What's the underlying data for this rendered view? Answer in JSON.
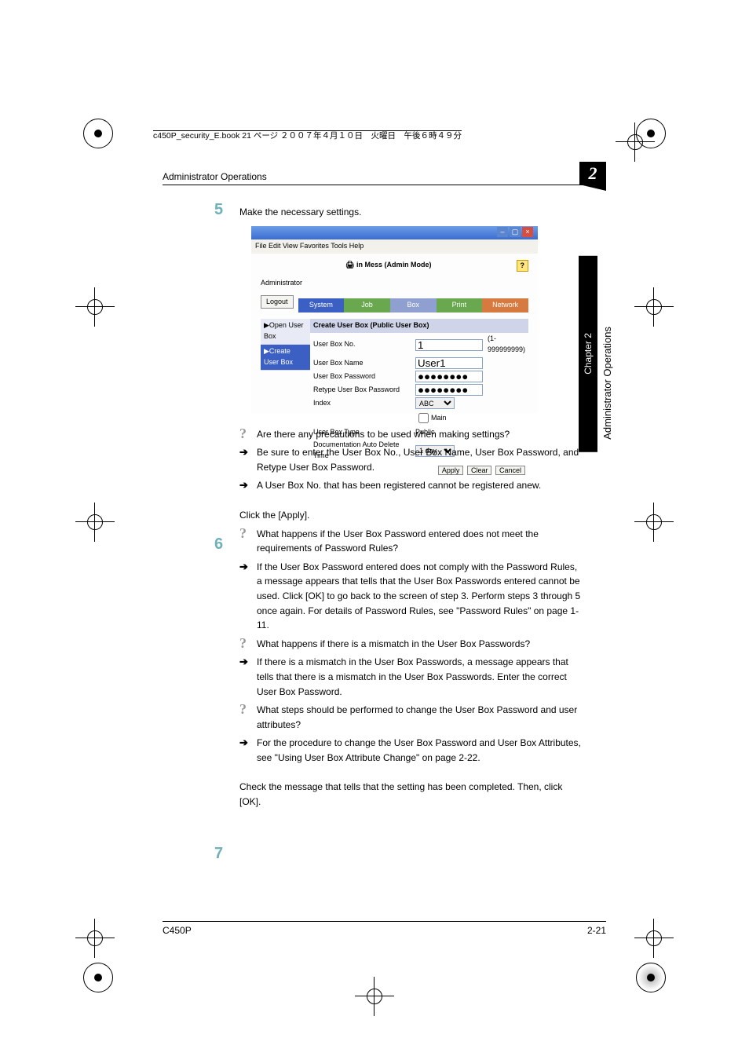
{
  "ruler": "c450P_security_E.book  21 ページ  ２００７年４月１０日　火曜日　午後６時４９分",
  "header": "Administrator Operations",
  "chapnum": "2",
  "side": {
    "chapter": "Chapter 2",
    "title": "Administrator Operations"
  },
  "steps": {
    "s5": "5",
    "s6": "6",
    "s7": "7"
  },
  "s5": {
    "t": "Make the necessary settings."
  },
  "shot": {
    "menus": "File   Edit   View   Favorites   Tools   Help",
    "title": "in Mess (Admin Mode)",
    "role": "Administrator",
    "logout": "Logout",
    "tabs": [
      "System",
      "Job",
      "Box",
      "Print",
      "Network"
    ],
    "nav": [
      "▶Open User Box",
      "▶Create User Box"
    ],
    "fh": "Create User Box (Public User Box)",
    "rows": {
      "no": {
        "l": "User Box No.",
        "v": "1",
        "h": "(1-999999999)"
      },
      "name": {
        "l": "User Box Name",
        "v": "User1"
      },
      "pw": {
        "l": "User Box Password",
        "v": "●●●●●●●●"
      },
      "rpw": {
        "l": "Retype User Box Password",
        "v": "●●●●●●●●"
      },
      "idx": {
        "l": "Index",
        "v": "ABC",
        "m": "Main"
      },
      "type": {
        "l": "User Box Type",
        "v": "Public"
      },
      "del": {
        "l": "Documentation Auto Delete Time",
        "v": "1 day"
      }
    },
    "btns": {
      "a": "Apply",
      "c": "Clear",
      "x": "Cancel"
    }
  },
  "q1": "Are there any precautions to be used when making settings?",
  "a1": "Be sure to enter the User Box No., User Box Name, User Box Password, and Retype User Box Password.",
  "a1b": "A User Box No. that has been registered cannot be registered anew.",
  "s6": {
    "t": "Click the [Apply]."
  },
  "q2": "What happens if the User Box Password entered does not meet the requirements of Password Rules?",
  "a2": "If the User Box Password entered does not comply with the Password Rules, a message appears that tells that the User Box Passwords entered cannot be used. Click [OK] to go back to the screen of step 3. Perform steps 3 through 5 once again. For details of Password Rules, see \"Password Rules\" on page 1-11.",
  "q3": "What happens if there is a mismatch in the User Box Passwords?",
  "a3": "If there is a mismatch in the User Box Passwords, a message appears that tells that there is a mismatch in the User Box Passwords. Enter the correct User Box Password.",
  "q4": "What steps should be performed to change the User Box Password and user attributes?",
  "a4": "For the procedure to change the User Box Password and User Box Attributes, see \"Using User Box Attribute Change\" on page 2-22.",
  "s7": {
    "t": "Check the message that tells that the setting has been completed. Then, click [OK]."
  },
  "footer": {
    "l": "C450P",
    "r": "2-21"
  }
}
